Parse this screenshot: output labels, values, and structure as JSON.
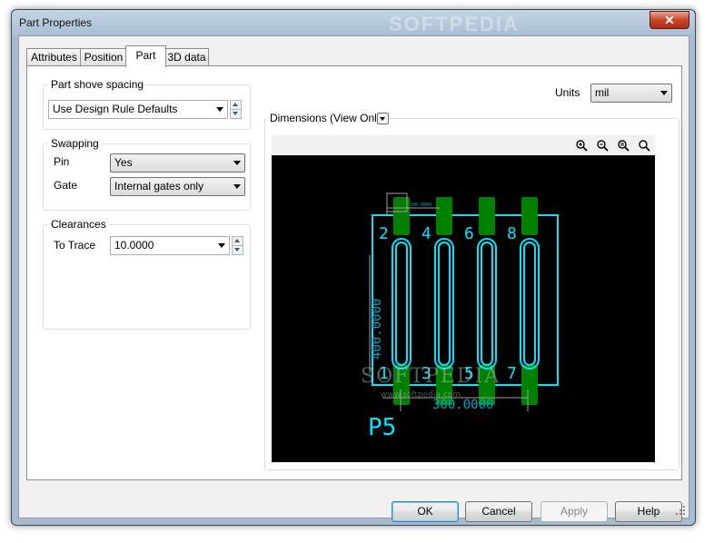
{
  "window": {
    "title": "Part Properties",
    "close_glyph": "✕",
    "watermark": "SOFTPEDIA"
  },
  "tabs": [
    {
      "label": "Attributes",
      "active": false
    },
    {
      "label": "Position",
      "active": false
    },
    {
      "label": "Part",
      "active": true
    },
    {
      "label": "3D data",
      "active": false
    }
  ],
  "part_shove": {
    "title": "Part shove spacing",
    "value": "Use Design Rule Defaults"
  },
  "swapping": {
    "title": "Swapping",
    "pin_label": "Pin",
    "pin_value": "Yes",
    "gate_label": "Gate",
    "gate_value": "Internal gates only"
  },
  "clearances": {
    "title": "Clearances",
    "to_trace_label": "To Trace",
    "to_trace_value": "10.0000"
  },
  "units": {
    "label": "Units",
    "value": "mil"
  },
  "dimensions": {
    "title": "Dimensions (View Only)",
    "toolbar_icons": [
      "zoom-in-icon",
      "zoom-out-icon",
      "zoom-previous-icon",
      "zoom-fit-icon"
    ],
    "preview": {
      "part_label": "P5",
      "dim_vertical": "400.0000",
      "dim_horizontal": "300.0000",
      "dim_small": "100.0000",
      "top_pin_labels": [
        "2",
        "4",
        "6",
        "8"
      ],
      "bottom_pin_labels": [
        "1",
        "3",
        "5",
        "7"
      ],
      "watermark": "SOFTPEDIA",
      "watermark_url": "www.softpedia.com",
      "colors": {
        "background": "#000000",
        "pad": "#008000",
        "outline": "#00e5ff"
      }
    }
  },
  "buttons": {
    "ok": "OK",
    "cancel": "Cancel",
    "apply": "Apply",
    "help": "Help"
  }
}
